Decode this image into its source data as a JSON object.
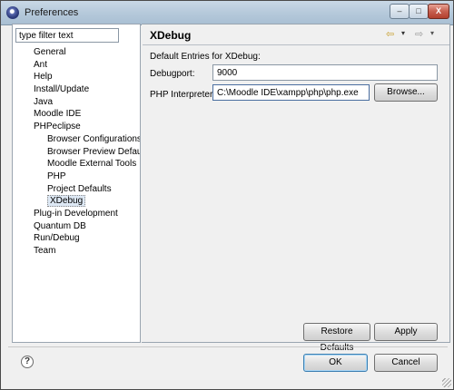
{
  "window": {
    "title": "Preferences"
  },
  "titlebar_buttons": {
    "minimize": "–",
    "maximize": "□",
    "close": "X"
  },
  "filter": {
    "placeholder": "type filter text",
    "value": "type filter text"
  },
  "tree": {
    "items": [
      {
        "label": "General",
        "level": 0
      },
      {
        "label": "Ant",
        "level": 0
      },
      {
        "label": "Help",
        "level": 0
      },
      {
        "label": "Install/Update",
        "level": 0
      },
      {
        "label": "Java",
        "level": 0
      },
      {
        "label": "Moodle IDE",
        "level": 0
      },
      {
        "label": "PHPeclipse",
        "level": 0
      },
      {
        "label": "Browser Configurations",
        "level": 1
      },
      {
        "label": "Browser Preview Defaults",
        "level": 1
      },
      {
        "label": "Moodle External Tools",
        "level": 1
      },
      {
        "label": "PHP",
        "level": 1
      },
      {
        "label": "Project Defaults",
        "level": 1
      },
      {
        "label": "XDebug",
        "level": 1,
        "selected": true
      },
      {
        "label": "Plug-in Development",
        "level": 0
      },
      {
        "label": "Quantum DB",
        "level": 0
      },
      {
        "label": "Run/Debug",
        "level": 0
      },
      {
        "label": "Team",
        "level": 0
      }
    ]
  },
  "page": {
    "title": "XDebug",
    "section_label": "Default Entries for XDebug:",
    "debugport_label": "Debugport:",
    "debugport_value": "9000",
    "php_interpreter_label": "PHP Interpreter:",
    "php_interpreter_value": "C:\\Moodle IDE\\xampp\\php\\php.exe",
    "browse_label": "Browse...",
    "restore_defaults_label": "Restore Defaults",
    "apply_label": "Apply"
  },
  "nav": {
    "back_icon": "⇦",
    "dropdown_icon": "▾",
    "forward_icon": "⇨"
  },
  "footer": {
    "help_icon": "?",
    "ok_label": "OK",
    "cancel_label": "Cancel"
  }
}
